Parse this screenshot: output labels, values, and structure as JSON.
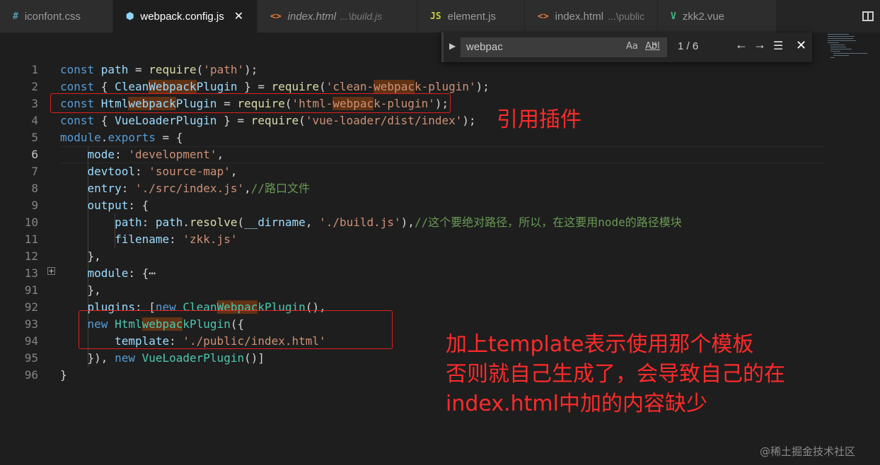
{
  "tabs": [
    {
      "icon": "#",
      "icon_color": "#519aba",
      "label": "iconfont.css",
      "path": "",
      "active": false,
      "italic": false
    },
    {
      "icon": "⬢",
      "icon_color": "#8dd6f9",
      "label": "webpack.config.js",
      "path": "",
      "active": true,
      "italic": false,
      "close": "✕"
    },
    {
      "icon": "<>",
      "icon_color": "#e37933",
      "label": "index.html",
      "path": "...\\build.js",
      "active": false,
      "italic": true
    },
    {
      "icon": "JS",
      "icon_color": "#cbcb41",
      "label": "element.js",
      "path": "",
      "active": false,
      "italic": false
    },
    {
      "icon": "<>",
      "icon_color": "#e37933",
      "label": "index.html",
      "path": "...\\public",
      "active": false,
      "italic": false
    },
    {
      "icon": "V",
      "icon_color": "#41b883",
      "label": "zkk2.vue",
      "path": "",
      "active": false,
      "italic": false
    }
  ],
  "find": {
    "query": "webpac",
    "match_case": "Aa",
    "whole_word": "Abl",
    "regex": ".*",
    "count": "1 / 6",
    "prev": "←",
    "next": "→",
    "close": "✕"
  },
  "code": {
    "current_line": "6",
    "lines": [
      {
        "n": "1",
        "tokens": [
          [
            "k",
            "const "
          ],
          [
            "v",
            "path"
          ],
          [
            "p",
            " = "
          ],
          [
            "f",
            "require"
          ],
          [
            "p",
            "("
          ],
          [
            "s",
            "'path'"
          ],
          [
            "p",
            ");"
          ]
        ]
      },
      {
        "n": "2",
        "tokens": [
          [
            "k",
            "const "
          ],
          [
            "p",
            "{ "
          ],
          [
            "v",
            "Clean"
          ],
          [
            "v",
            "Webpack",
            "hl"
          ],
          [
            "v",
            "Plugin"
          ],
          [
            "p",
            " } = "
          ],
          [
            "f",
            "require"
          ],
          [
            "p",
            "("
          ],
          [
            "s",
            "'clean-"
          ],
          [
            "s",
            "webpac",
            "hl"
          ],
          [
            "s",
            "k-plugin'"
          ],
          [
            "p",
            ");"
          ]
        ]
      },
      {
        "n": "3",
        "tokens": [
          [
            "k",
            "const "
          ],
          [
            "v",
            "Html"
          ],
          [
            "v",
            "webpack",
            "hl"
          ],
          [
            "v",
            "Plugin"
          ],
          [
            "p",
            " = "
          ],
          [
            "f",
            "require"
          ],
          [
            "p",
            "("
          ],
          [
            "s",
            "'html-"
          ],
          [
            "s",
            "webpac",
            "hl"
          ],
          [
            "s",
            "k-plugin'"
          ],
          [
            "p",
            ");"
          ]
        ]
      },
      {
        "n": "4",
        "tokens": [
          [
            "k",
            "const "
          ],
          [
            "p",
            "{ "
          ],
          [
            "v",
            "VueLoaderPlugin"
          ],
          [
            "p",
            " } = "
          ],
          [
            "f",
            "require"
          ],
          [
            "p",
            "("
          ],
          [
            "s",
            "'vue-loader/dist/index'"
          ],
          [
            "p",
            ");"
          ]
        ]
      },
      {
        "n": "5",
        "tokens": [
          [
            "k",
            "module"
          ],
          [
            "p",
            "."
          ],
          [
            "k",
            "exports"
          ],
          [
            "p",
            " = {"
          ]
        ]
      },
      {
        "n": "6",
        "tokens": [
          [
            "p",
            "    "
          ],
          [
            "v",
            "mode"
          ],
          [
            "p",
            ": "
          ],
          [
            "s",
            "'development'"
          ],
          [
            "p",
            ","
          ]
        ]
      },
      {
        "n": "7",
        "tokens": [
          [
            "p",
            "    "
          ],
          [
            "v",
            "devtool"
          ],
          [
            "p",
            ": "
          ],
          [
            "s",
            "'source-map'"
          ],
          [
            "p",
            ","
          ]
        ]
      },
      {
        "n": "8",
        "tokens": [
          [
            "p",
            "    "
          ],
          [
            "v",
            "entry"
          ],
          [
            "p",
            ": "
          ],
          [
            "s",
            "'./src/index.js'"
          ],
          [
            "p",
            ","
          ],
          [
            "c",
            "//路口文件"
          ]
        ]
      },
      {
        "n": "9",
        "tokens": [
          [
            "p",
            "    "
          ],
          [
            "v",
            "output"
          ],
          [
            "p",
            ": {"
          ]
        ]
      },
      {
        "n": "10",
        "tokens": [
          [
            "p",
            "        "
          ],
          [
            "v",
            "path"
          ],
          [
            "p",
            ": "
          ],
          [
            "v",
            "path"
          ],
          [
            "p",
            "."
          ],
          [
            "f",
            "resolve"
          ],
          [
            "p",
            "("
          ],
          [
            "v",
            "__dirname"
          ],
          [
            "p",
            ", "
          ],
          [
            "s",
            "'./build.js'"
          ],
          [
            "p",
            "),"
          ],
          [
            "c",
            "//这个要绝对路径，所以，在这要用node的路径模块"
          ]
        ]
      },
      {
        "n": "11",
        "tokens": [
          [
            "p",
            "        "
          ],
          [
            "v",
            "filename"
          ],
          [
            "p",
            ": "
          ],
          [
            "s",
            "'zkk.js'"
          ]
        ]
      },
      {
        "n": "12",
        "tokens": [
          [
            "p",
            "    },"
          ]
        ]
      },
      {
        "n": "13",
        "tokens": [
          [
            "p",
            "    "
          ],
          [
            "v",
            "module"
          ],
          [
            "p",
            ": {⋯"
          ]
        ]
      },
      {
        "n": "91",
        "tokens": [
          [
            "p",
            "    },"
          ]
        ]
      },
      {
        "n": "92",
        "tokens": [
          [
            "p",
            "    "
          ],
          [
            "v",
            "plugins"
          ],
          [
            "p",
            ": ["
          ],
          [
            "k",
            "new "
          ],
          [
            "t",
            "Clean"
          ],
          [
            "t",
            "Webpac",
            "hl"
          ],
          [
            "t",
            "kPlugin"
          ],
          [
            "p",
            "(),"
          ]
        ]
      },
      {
        "n": "93",
        "tokens": [
          [
            "p",
            "    "
          ],
          [
            "k",
            "new "
          ],
          [
            "t",
            "Html"
          ],
          [
            "t",
            "webpac",
            "hl"
          ],
          [
            "t",
            "kPlugin"
          ],
          [
            "p",
            "({"
          ]
        ]
      },
      {
        "n": "94",
        "tokens": [
          [
            "p",
            "        "
          ],
          [
            "v",
            "template"
          ],
          [
            "p",
            ": "
          ],
          [
            "s",
            "'./public/index.html'"
          ]
        ]
      },
      {
        "n": "95",
        "tokens": [
          [
            "p",
            "    }), "
          ],
          [
            "k",
            "new "
          ],
          [
            "t",
            "VueLoaderPlugin"
          ],
          [
            "p",
            "()]"
          ]
        ]
      },
      {
        "n": "96",
        "tokens": [
          [
            "p",
            "}"
          ]
        ]
      }
    ]
  },
  "annotations": {
    "import_note": "引用插件",
    "template_note_1": "加上template表示使用那个模板",
    "template_note_2": "否则就自己生成了，会导致自己的在",
    "template_note_3": "index.html中加的内容缺少"
  },
  "watermark": "@稀土掘金技术社区",
  "colors": {
    "editor_bg": "#1e1e1e",
    "annotation_red": "#ff2a2a",
    "find_highlight": "#613214"
  }
}
